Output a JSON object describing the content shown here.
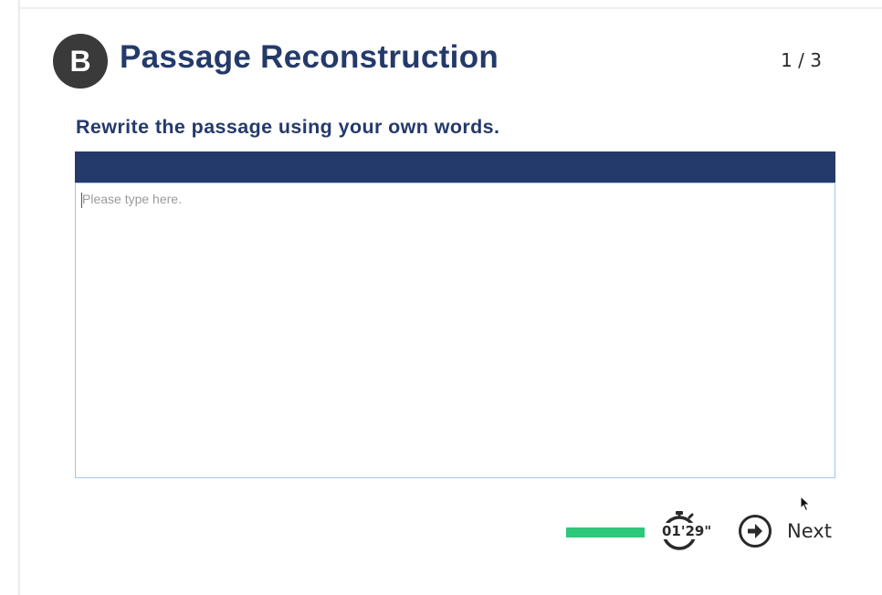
{
  "header": {
    "section_letter": "B",
    "title": "Passage Reconstruction",
    "progress": "1 / 3"
  },
  "task": {
    "instruction": "Rewrite the passage using your own words.",
    "answer_placeholder": "Please type here.",
    "answer_value": ""
  },
  "footer": {
    "time_remaining_fraction": 1.0,
    "time_bar_color": "#2fc779",
    "timer_text": "01'29\"",
    "next_label": "Next"
  },
  "colors": {
    "brand_navy": "#243a6b",
    "badge_dark": "#3a3a3a",
    "textbox_border": "#9fc8ee"
  },
  "icons": {
    "timer": "stopwatch-icon",
    "next": "arrow-right-circle-icon"
  }
}
